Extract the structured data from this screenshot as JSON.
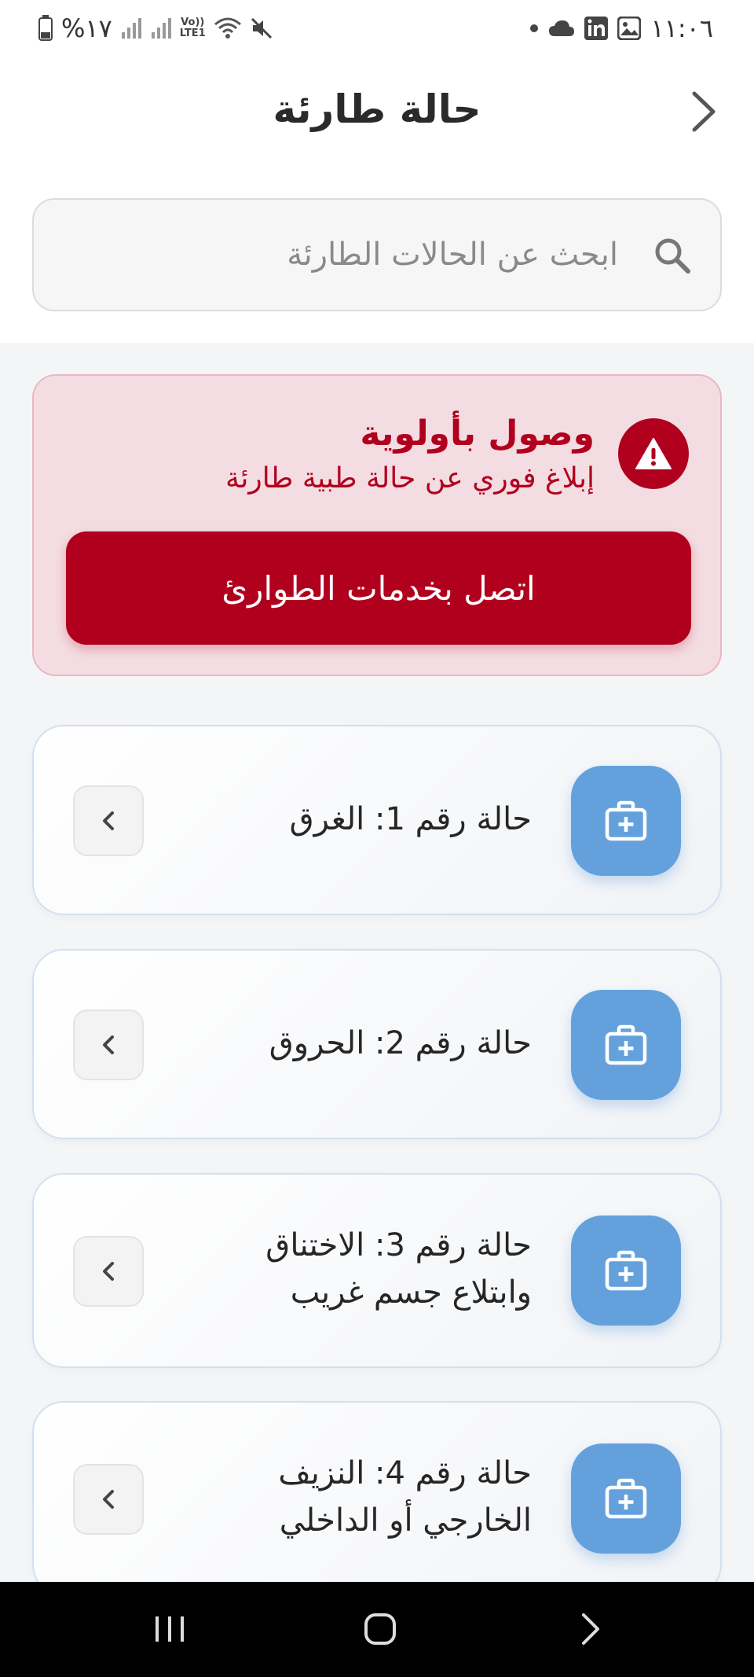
{
  "status_bar": {
    "time": "١١:٠٦",
    "battery_percent": "%١٧",
    "network_label": "LTE1",
    "volte_label": "Vo))"
  },
  "header": {
    "title": "حالة طارئة"
  },
  "search": {
    "placeholder": "ابحث عن الحالات الطارئة",
    "value": ""
  },
  "priority_card": {
    "title": "وصول بأولوية",
    "subtitle": "إبلاغ فوري عن حالة طبية طارئة",
    "call_button_label": "اتصل بخدمات الطوارئ",
    "accent_color": "#b1001e",
    "background_color": "#f4dde2"
  },
  "cases": [
    {
      "line1": "حالة رقم 1: الغرق",
      "line2": ""
    },
    {
      "line1": "حالة رقم 2: الحروق",
      "line2": ""
    },
    {
      "line1": "حالة رقم 3: الاختناق",
      "line2": "وابتلاع جسم غريب"
    },
    {
      "line1": "حالة رقم 4: النزيف",
      "line2": "الخارجي أو الداخلي"
    }
  ],
  "case_icon_color": "#64a1dc",
  "icons": {
    "back": "chevron-right-icon",
    "search": "search-icon",
    "alert": "warning-triangle-icon",
    "case": "medical-kit-icon",
    "case_arrow": "chevron-left-icon"
  }
}
